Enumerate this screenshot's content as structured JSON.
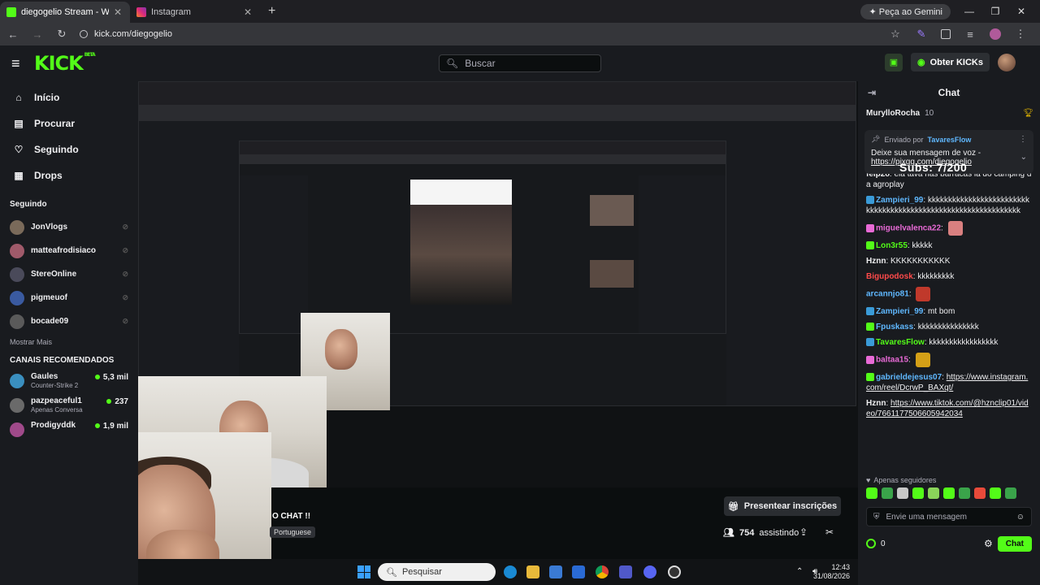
{
  "browser": {
    "tabs": [
      {
        "title": "diegogelio Stream - Watch Live",
        "active": true
      },
      {
        "title": "Instagram",
        "active": false
      }
    ],
    "gemini_label": "Peça ao Gemini",
    "url": "kick.com/diegogelio"
  },
  "header": {
    "logo": "KICK",
    "logo_badge": "BETA",
    "search_placeholder": "Buscar",
    "kicks_label": "Obter KICKs"
  },
  "sidebar": {
    "nav": [
      {
        "label": "Início",
        "icon": "home-icon"
      },
      {
        "label": "Procurar",
        "icon": "browse-icon"
      },
      {
        "label": "Seguindo",
        "icon": "heart-icon"
      },
      {
        "label": "Drops",
        "icon": "drops-icon"
      }
    ],
    "following_title": "Seguindo",
    "following": [
      {
        "name": "JonVlogs",
        "color": "#7a6a5a"
      },
      {
        "name": "matteafrodisiaco",
        "color": "#a05a6a"
      },
      {
        "name": "StereOnline",
        "color": "#4a4a5a"
      },
      {
        "name": "pigmeuof",
        "color": "#3a5aa0"
      },
      {
        "name": "bocade09",
        "color": "#5a5a5a"
      }
    ],
    "more_label": "Mostrar Mais",
    "recommended_title": "CANAIS RECOMENDADOS",
    "recommended": [
      {
        "name": "Gaules",
        "game": "Counter-Strike 2",
        "viewers": "5,3 mil",
        "color": "#3a8fbf"
      },
      {
        "name": "pazpeaceful1",
        "game": "Apenas Conversa",
        "viewers": "237",
        "color": "#6a6a6a"
      },
      {
        "name": "Prodigyddk",
        "game": "",
        "viewers": "1,9 mil",
        "color": "#a04a8a"
      }
    ]
  },
  "stream": {
    "overlay_chat_text": "O CHAT !!",
    "language": "Portuguese",
    "present_label": "Presentear inscrições",
    "viewers": "754",
    "viewers_label": "assistindo"
  },
  "taskbar": {
    "search_placeholder": "Pesquisar",
    "time": "12:43",
    "date": "31/08/2026"
  },
  "chat": {
    "title": "Chat",
    "pinned_user": "MurylloRocha",
    "pinned_points": "10",
    "pinned_card": {
      "sent_by": "Enviado por",
      "user": "TavaresFlow",
      "message": "Deixe sua mensagem de voz -",
      "link": "https://pixgg.com/diegogelio"
    },
    "subs_overlay": "Subs: 7/200",
    "messages": [
      {
        "user": "felp28",
        "color": "#efeff1",
        "badge": "",
        "text": "eia tava nas barracas lá do camping da agroplay",
        "emote": ""
      },
      {
        "user": "Zampieri_99",
        "color": "#5fb8ff",
        "badge": "#3a9bd8",
        "text": "kkkkkkkkkkkkkkkkkkkkkkkkkkkkkkkkkkkkkkkkkkkkkkkkkkkkkkkkkkkkkkk",
        "emote": ""
      },
      {
        "user": "miguelvalenca22",
        "color": "#e86ad6",
        "badge": "#e86ad6",
        "text": "",
        "emote": "#d98080"
      },
      {
        "user": "Lon3r55",
        "color": "#53fc18",
        "badge": "#53fc18",
        "text": "kkkkk",
        "emote": ""
      },
      {
        "user": "Hznn",
        "color": "#efeff1",
        "badge": "",
        "text": "KKKKKKKKKKK",
        "emote": ""
      },
      {
        "user": "Bigupodosk",
        "color": "#ff4a4a",
        "badge": "",
        "text": "kkkkkkkkk",
        "emote": ""
      },
      {
        "user": "arcannjo81",
        "color": "#5fb8ff",
        "badge": "",
        "text": "",
        "emote": "#c0392b"
      },
      {
        "user": "Zampieri_99",
        "color": "#5fb8ff",
        "badge": "#3a9bd8",
        "text": "mt bom",
        "emote": ""
      },
      {
        "user": "Fpuskass",
        "color": "#5fb8ff",
        "badge": "#53fc18",
        "text": "kkkkkkkkkkkkkkk",
        "emote": ""
      },
      {
        "user": "TavaresFlow",
        "color": "#53fc18",
        "badge": "#3a9bd8",
        "text": "kkkkkkkkkkkkkkkkk",
        "emote": ""
      },
      {
        "user": "baltaa15",
        "color": "#e86ad6",
        "badge": "#e86ad6",
        "text": "",
        "emote": "#d4a017"
      },
      {
        "user": "gabrieldejesus07",
        "color": "#5fb8ff",
        "badge": "#53fc18",
        "text": "https://www.instagram.com/reel/DcrwP_BAXqt/",
        "emote": ""
      },
      {
        "user": "Hznn",
        "color": "#efeff1",
        "badge": "",
        "text": "https://www.tiktok.com/@hznclip01/video/7661177506605942034",
        "emote": ""
      }
    ],
    "followers_only": "Apenas seguidores",
    "input_placeholder": "Envie uma mensagem",
    "kicks_count": "0",
    "send_label": "Chat"
  }
}
